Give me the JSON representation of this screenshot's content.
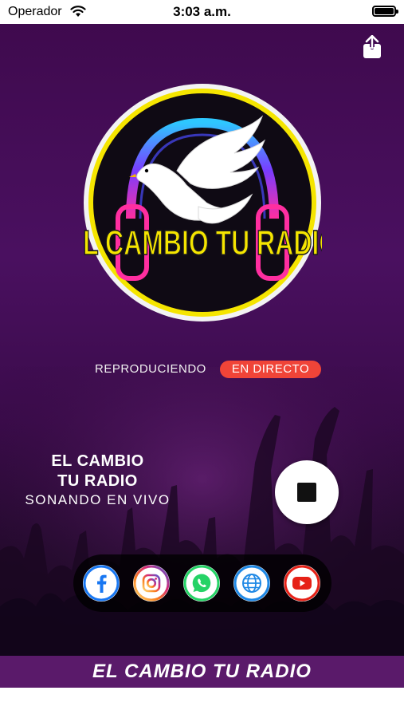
{
  "status_bar": {
    "carrier": "Operador",
    "time": "3:03 a.m."
  },
  "logo": {
    "text": "EL CAMBIO TU RADIO"
  },
  "now_playing": {
    "label": "REPRODUCIENDO",
    "badge": "EN  DIRECTO"
  },
  "station": {
    "line1": "EL CAMBIO",
    "line2": "TU RADIO",
    "status": "SONANDO EN VIVO"
  },
  "social": [
    {
      "name": "facebook",
      "icon": "facebook-icon",
      "color": "#1877f2"
    },
    {
      "name": "instagram",
      "icon": "instagram-icon",
      "color": "#e1306c"
    },
    {
      "name": "whatsapp",
      "icon": "whatsapp-icon",
      "color": "#25d366"
    },
    {
      "name": "website",
      "icon": "globe-icon",
      "color": "#1e88e5"
    },
    {
      "name": "youtube",
      "icon": "youtube-icon",
      "color": "#e62117"
    }
  ],
  "footer": {
    "title": "EL CAMBIO TU RADIO"
  },
  "colors": {
    "background": "#4a1060",
    "accent": "#f04438",
    "footer": "#5a1a6a",
    "logo_yellow": "#f5e500"
  }
}
